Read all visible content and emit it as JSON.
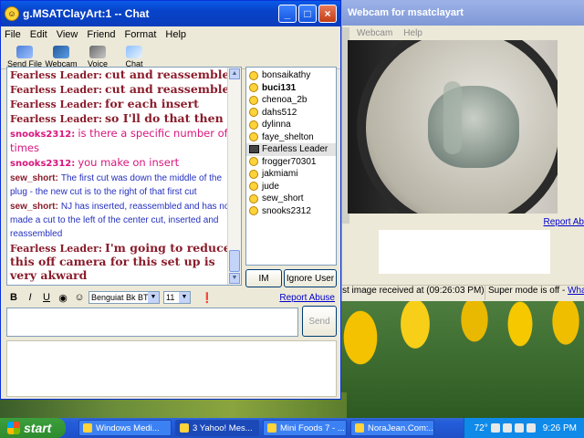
{
  "chat_window": {
    "title": "g.MSATClayArt:1 -- Chat",
    "menu": [
      "File",
      "Edit",
      "View",
      "Friend",
      "Format",
      "Help"
    ],
    "toolbar": [
      "Send File",
      "Webcam",
      "Voice",
      "Chat"
    ],
    "messages": [
      {
        "nick": "Fearless Leader:",
        "text": "cut and reassemble",
        "style": "fl"
      },
      {
        "nick": "Fearless Leader:",
        "text": "cut and reassemble",
        "style": "fl"
      },
      {
        "nick": "Fearless Leader:",
        "text": "for each insert",
        "style": "fl"
      },
      {
        "nick": "Fearless Leader:",
        "text": "so I'll do that then",
        "style": "fl"
      },
      {
        "nick": "snooks2312:",
        "text": "is there a specific number of times",
        "style": "sn"
      },
      {
        "nick": "snooks2312:",
        "text": "you make on insert",
        "style": "sn"
      },
      {
        "nick": "sew_short:",
        "text": "The first cut was down the middle of the plug - the new cut is to the right of that first cut",
        "style": "sew"
      },
      {
        "nick": "sew_short:",
        "text": "NJ has inserted, reassembled and has now made a cut to the left of the center cut, inserted and reassembled",
        "style": "sew"
      },
      {
        "nick": "Fearless Leader:",
        "text": "I'm going to reduce this off camera for this set up is very akward",
        "style": "fl"
      }
    ],
    "users": [
      {
        "name": "bonsaikathy",
        "bold": false,
        "cam": false,
        "selected": false
      },
      {
        "name": "buci131",
        "bold": true,
        "cam": false,
        "selected": false
      },
      {
        "name": "chenoa_2b",
        "bold": false,
        "cam": false,
        "selected": false
      },
      {
        "name": "dahs512",
        "bold": false,
        "cam": false,
        "selected": false
      },
      {
        "name": "dylinna",
        "bold": false,
        "cam": false,
        "selected": false
      },
      {
        "name": "faye_shelton",
        "bold": false,
        "cam": false,
        "selected": false
      },
      {
        "name": "Fearless Leader",
        "bold": false,
        "cam": true,
        "selected": true
      },
      {
        "name": "frogger70301",
        "bold": false,
        "cam": false,
        "selected": false
      },
      {
        "name": "jakmiami",
        "bold": false,
        "cam": false,
        "selected": false
      },
      {
        "name": "jude",
        "bold": false,
        "cam": false,
        "selected": false
      },
      {
        "name": "sew_short",
        "bold": false,
        "cam": false,
        "selected": false
      },
      {
        "name": "snooks2312",
        "bold": false,
        "cam": false,
        "selected": false
      }
    ],
    "im_label": "IM",
    "ignore_label": "Ignore User",
    "format": {
      "bold": "B",
      "italic": "I",
      "underline": "U",
      "font": "Benguiat Bk BT",
      "size": "11"
    },
    "report_abuse": "Report Abuse",
    "send_label": "Send"
  },
  "webcam_window": {
    "title": "Webcam for msatclayart",
    "menu": [
      "Webcam",
      "Help"
    ],
    "report": "Report Ab",
    "status_left": "st image received at (09:26:03 PM)",
    "status_right": "Super mode is off - ",
    "status_link": "What's th"
  },
  "taskbar": {
    "start": "start",
    "tasks": [
      {
        "label": "Windows Medi...",
        "active": false
      },
      {
        "label": "3 Yahoo! Mes...",
        "active": true
      },
      {
        "label": "Mini Foods 7 - ...",
        "active": false
      },
      {
        "label": "NoraJean.Com:...",
        "active": false
      }
    ],
    "temp": "72°",
    "clock": "9:26 PM"
  }
}
